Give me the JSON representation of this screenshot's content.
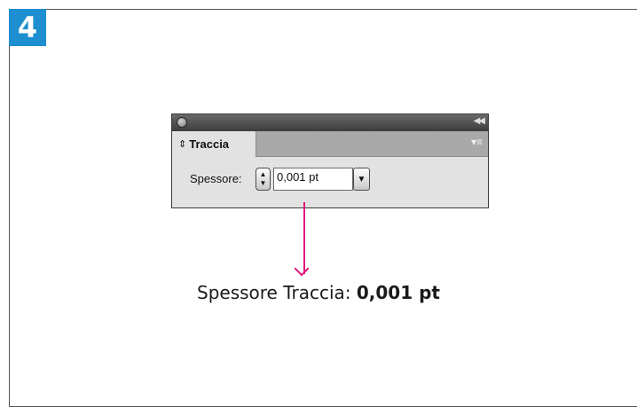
{
  "step": {
    "number": "4",
    "color": "#1d8fd1"
  },
  "panel": {
    "tab_label": "Traccia",
    "tab_icon": "up-down-arrows-icon",
    "menu_icon": "panel-menu-icon",
    "collapse_icon": "double-chevron-left-icon",
    "stroke_label": "Spessore:",
    "stroke_value": "0,001 pt"
  },
  "arrow": {
    "color": "#e0197d"
  },
  "caption": {
    "prefix": "Spessore Traccia: ",
    "value": "0,001 pt"
  }
}
